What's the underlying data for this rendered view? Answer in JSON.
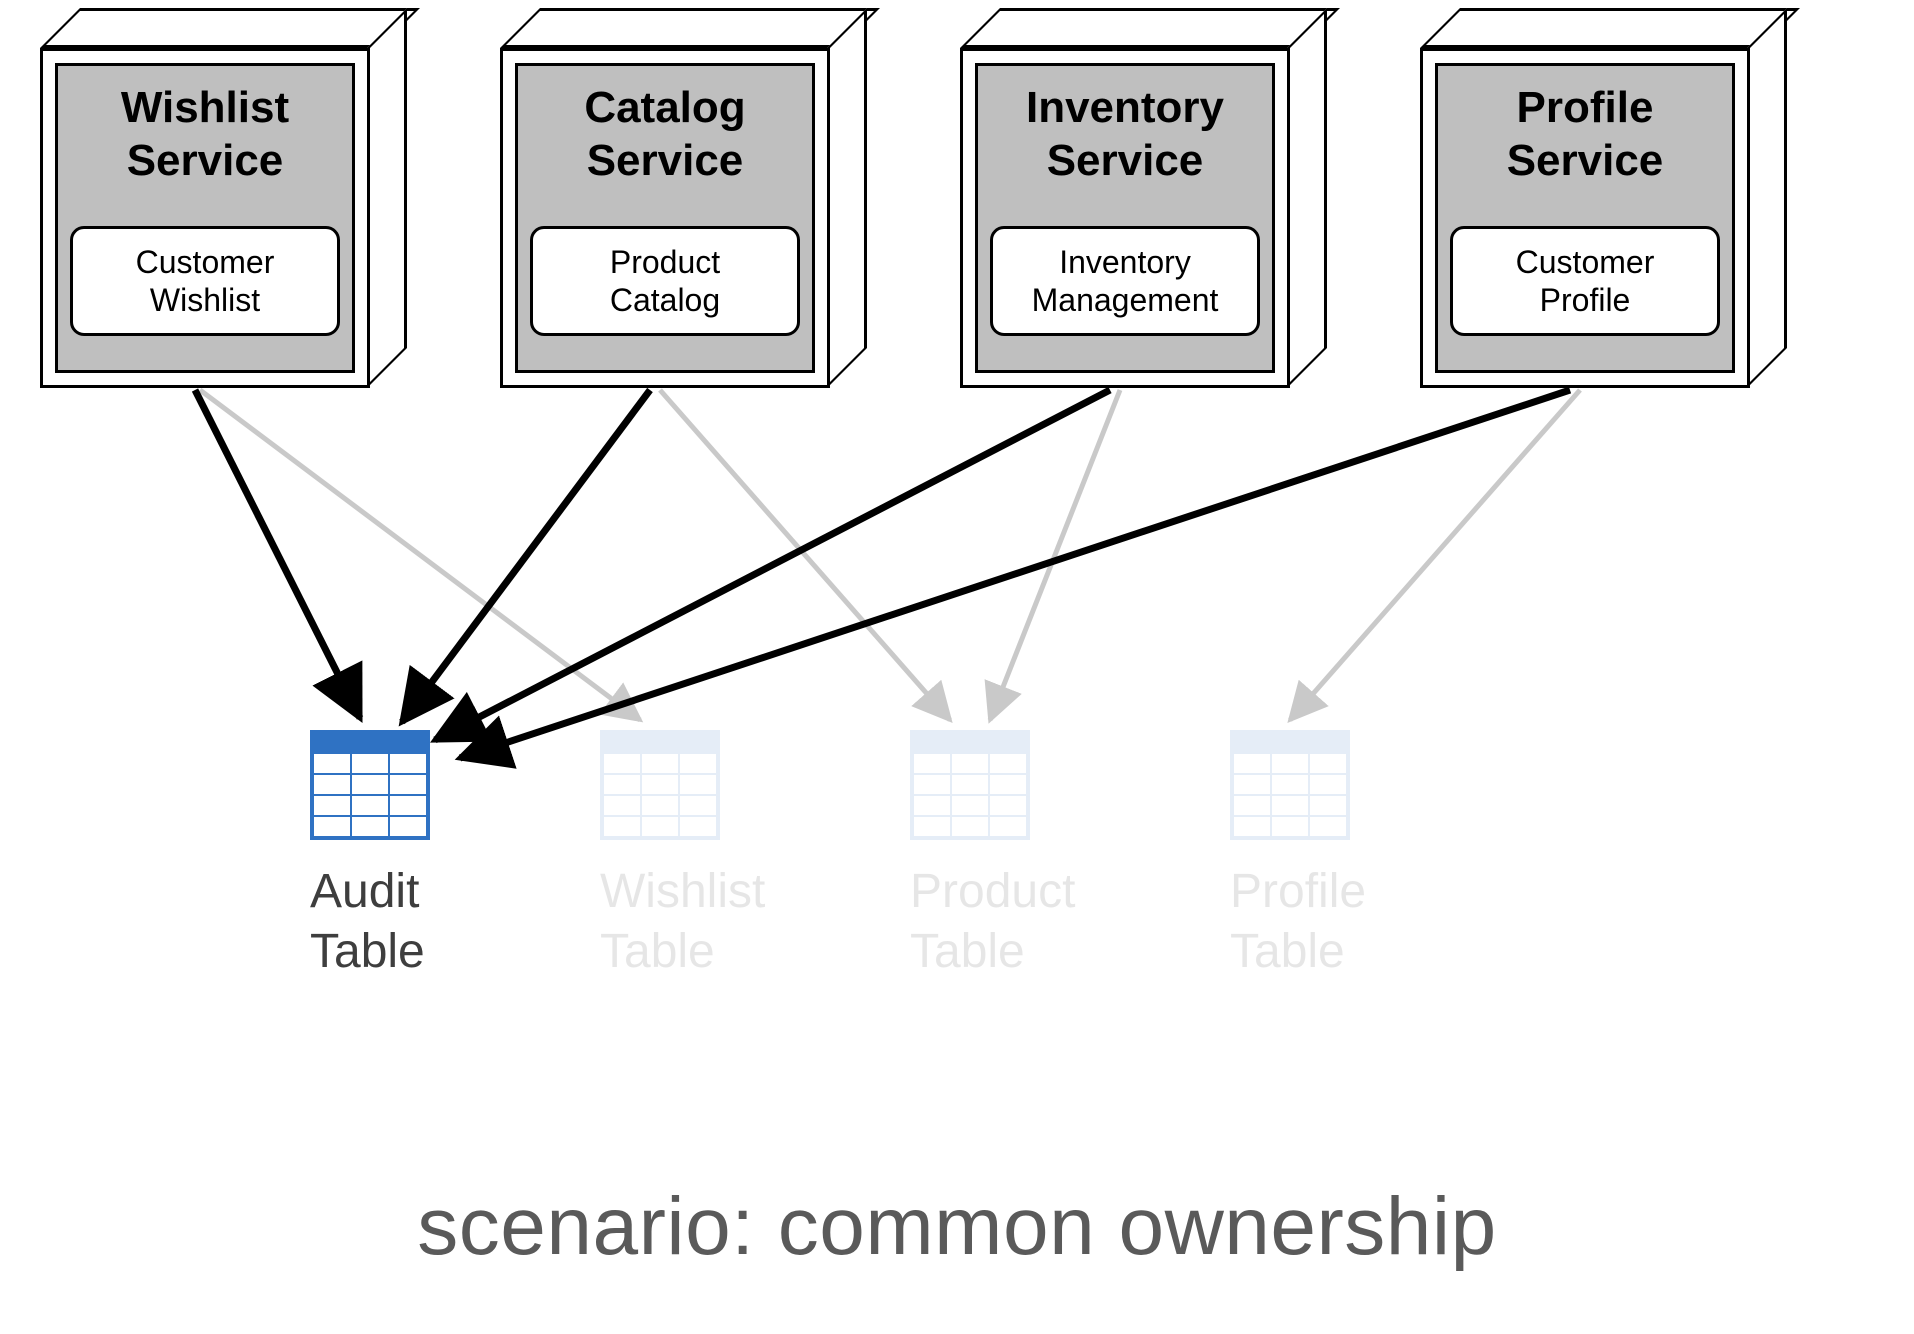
{
  "services": [
    {
      "title_line1": "Wishlist",
      "title_line2": "Service",
      "module_line1": "Customer",
      "module_line2": "Wishlist"
    },
    {
      "title_line1": "Catalog",
      "title_line2": "Service",
      "module_line1": "Product",
      "module_line2": "Catalog"
    },
    {
      "title_line1": "Inventory",
      "title_line2": "Service",
      "module_line1": "Inventory",
      "module_line2": "Management"
    },
    {
      "title_line1": "Profile",
      "title_line2": "Service",
      "module_line1": "Customer",
      "module_line2": "Profile"
    }
  ],
  "tables": [
    {
      "label_line1": "Audit",
      "label_line2": "Table",
      "faded": false
    },
    {
      "label_line1": "Wishlist",
      "label_line2": "Table",
      "faded": true
    },
    {
      "label_line1": "Product",
      "label_line2": "Table",
      "faded": true
    },
    {
      "label_line1": "Profile",
      "label_line2": "Table",
      "faded": true
    }
  ],
  "caption": "scenario: common ownership",
  "colors": {
    "table_primary": "#2f72c3",
    "table_faded": "#9fbfe6"
  }
}
